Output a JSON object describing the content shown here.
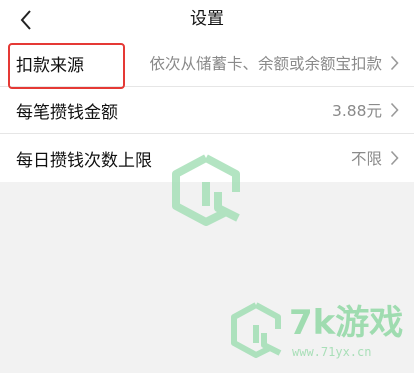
{
  "header": {
    "title": "设置"
  },
  "settings": [
    {
      "label": "扣款来源",
      "value": "依次从储蓄卡、余额或余额宝扣款"
    },
    {
      "label": "每笔攒钱金额",
      "value": "3.88元"
    },
    {
      "label": "每日攒钱次数上限",
      "value": "不限"
    }
  ],
  "watermark": {
    "brand": "7k游戏",
    "url": "www.71yx.cn"
  },
  "colors": {
    "highlight": "#e53935",
    "watermark": "#9fdcb0"
  }
}
